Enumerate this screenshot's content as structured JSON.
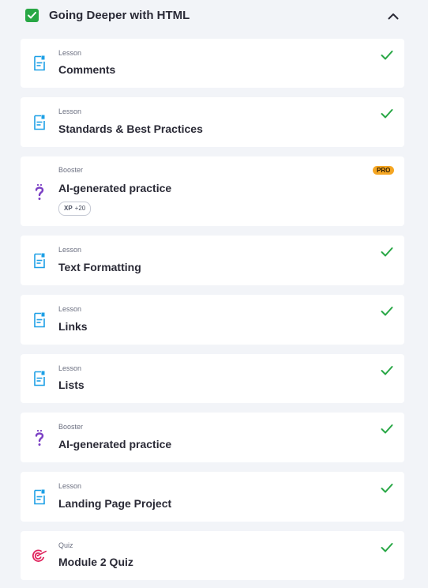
{
  "module": {
    "title": "Going Deeper with HTML",
    "completed": true
  },
  "colors": {
    "check": "#28a745",
    "lesson_icon": "#1ea0e6",
    "booster_icon": "#7b3fc4",
    "quiz_icon": "#e0245e",
    "pro_badge": "#f5a623"
  },
  "items": [
    {
      "type": "Lesson",
      "title": "Comments",
      "icon": "document-icon",
      "completed": true
    },
    {
      "type": "Lesson",
      "title": "Standards & Best Practices",
      "icon": "document-icon",
      "completed": true
    },
    {
      "type": "Booster",
      "title": "AI-generated practice",
      "icon": "question-icon",
      "completed": false,
      "badge": "PRO",
      "xp_label": "XP",
      "xp_value": "+20"
    },
    {
      "type": "Lesson",
      "title": "Text Formatting",
      "icon": "document-icon",
      "completed": true
    },
    {
      "type": "Lesson",
      "title": "Links",
      "icon": "document-icon",
      "completed": true
    },
    {
      "type": "Lesson",
      "title": "Lists",
      "icon": "document-icon",
      "completed": true
    },
    {
      "type": "Booster",
      "title": "AI-generated practice",
      "icon": "question-icon",
      "completed": true
    },
    {
      "type": "Lesson",
      "title": "Landing Page Project",
      "icon": "document-icon",
      "completed": true
    },
    {
      "type": "Quiz",
      "title": "Module 2 Quiz",
      "icon": "target-icon",
      "completed": true
    }
  ]
}
